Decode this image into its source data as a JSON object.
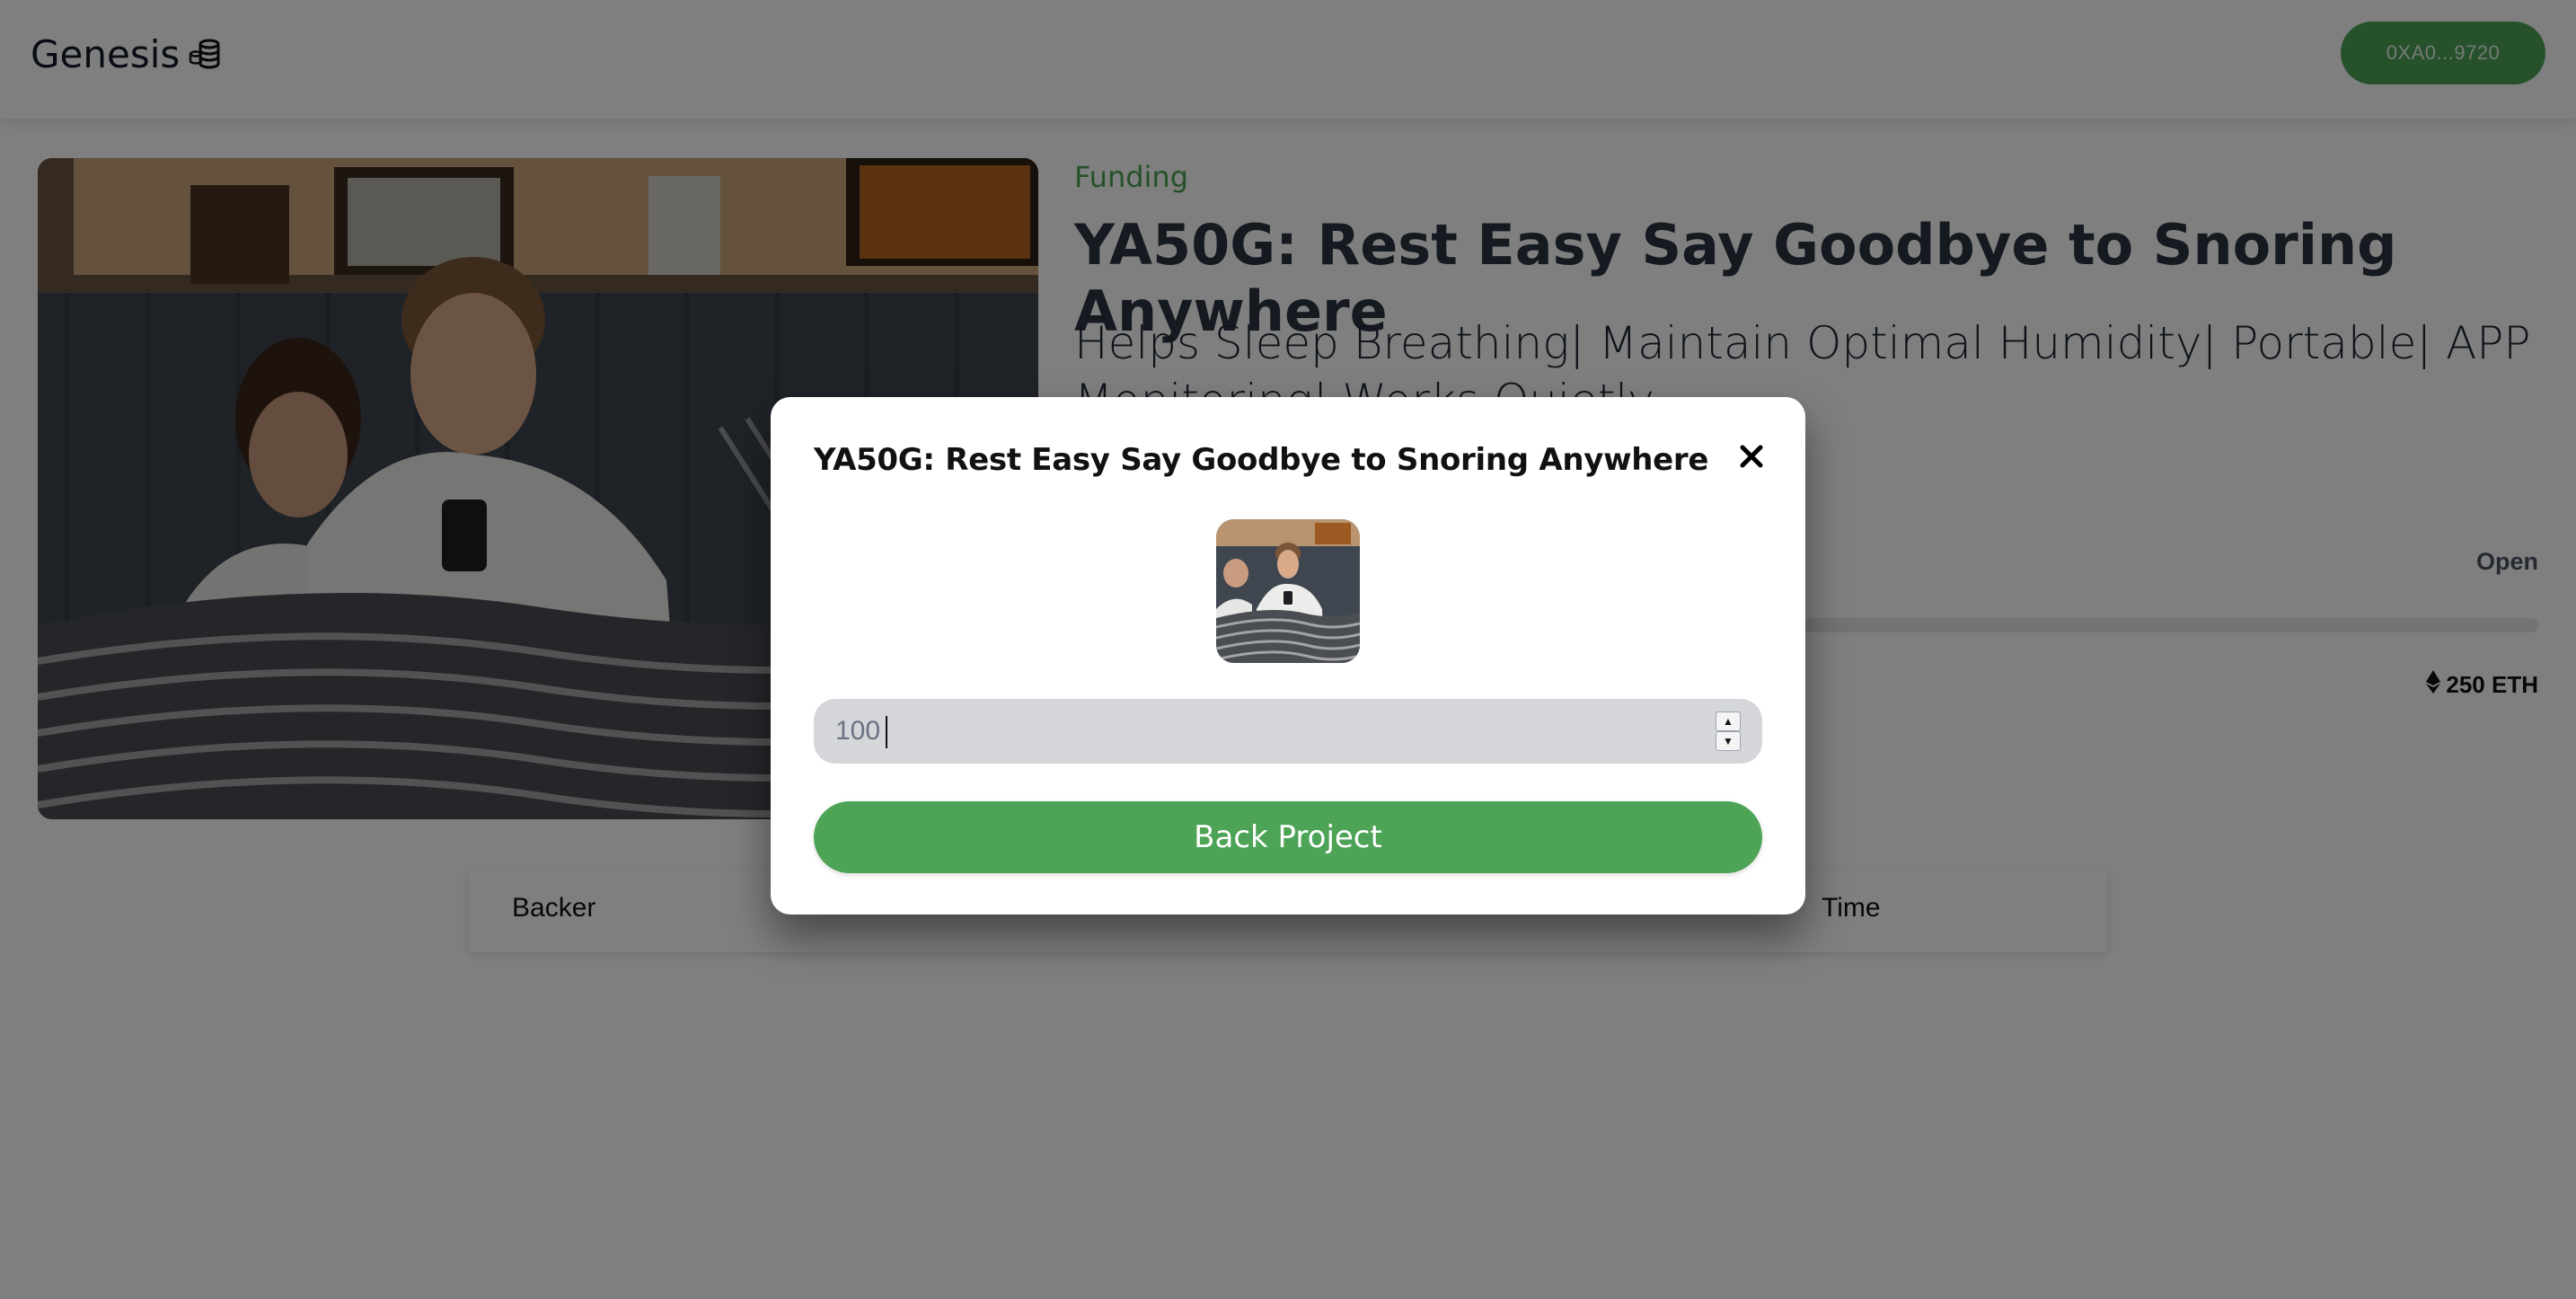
{
  "header": {
    "brand": "Genesis",
    "wallet_address": "0XA0...9720"
  },
  "project": {
    "status": "Funding",
    "title": "YA50G: Rest Easy Say Goodbye to Snoring Anywhere",
    "subtitle": "Helps Sleep Breathing| Maintain Optimal Humidity| Portable| APP Monitoring| Works Quietly",
    "state": "Open",
    "goal": "250 ETH",
    "progress": 0
  },
  "backers": {
    "columns": [
      "Backer",
      "Time"
    ]
  },
  "modal": {
    "title": "YA50G: Rest Easy Say Goodbye to Snoring Anywhere",
    "amount_value": "100",
    "back_label": "Back Project"
  },
  "colors": {
    "accent": "#4da356",
    "title": "#2b3240",
    "input_bg": "#d4d6da"
  },
  "icons": {
    "brand": "coins-icon",
    "close": "close-icon",
    "eth": "ethereum-icon"
  }
}
